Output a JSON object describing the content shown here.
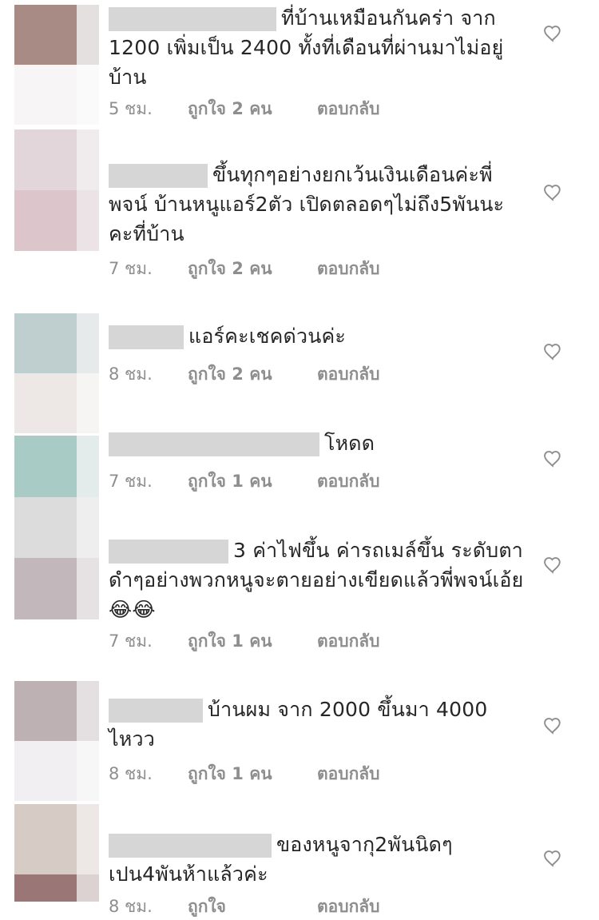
{
  "comments": [
    {
      "text": "ที่บ้านเหมือนกันคร่า จาก 1200 เพิ่มเป็น 2400 ทั้งที่เดือนที่ผ่านมาไม่อยู่บ้าน",
      "time": "5 ชม.",
      "likes": "ถูกใจ 2 คน",
      "reply": "ตอบกลับ",
      "avatar_colors": [
        "#a98b86",
        "#ece4e3"
      ]
    },
    {
      "text": "ขึ้นทุกๆอย่างยกเว้นเงินเดือนค่ะพี่พจน์ บ้านหนูแอร์2ตัว เปิดตลอดๆไม่ถึง5พันนะคะที่บ้าน",
      "time": "7 ชม.",
      "likes": "ถูกใจ 2 คน",
      "reply": "ตอบกลับ",
      "avatar_colors": [
        "#e2d6da",
        "#ddc5cc"
      ]
    },
    {
      "text": "แอร์คะเชคด่วนค่ะ",
      "time": "8 ชม.",
      "likes": "ถูกใจ 2 คน",
      "reply": "ตอบกลับ",
      "avatar_colors": [
        "#bfcfcf",
        "#ede8e5"
      ]
    },
    {
      "text": "โหดด",
      "time": "7 ชม.",
      "likes": "ถูกใจ 1 คน",
      "reply": "ตอบกลับ",
      "avatar_colors": [
        "#a9cbc6",
        "#dcdcdd"
      ]
    },
    {
      "text": "3 ค่าไฟขึ้น ค่ารถเมล์ขึ้น ระดับตาดำๆอย่างพวกหนูจะตายอย่างเขียดแล้วพี่พจน์เอ้ย😂😂",
      "time": "7 ชม.",
      "likes": "ถูกใจ 1 คน",
      "reply": "ตอบกลับ",
      "avatar_colors": [
        "#e0dde0",
        "#c2b8bb"
      ]
    },
    {
      "text": "บ้านผม จาก 2000 ขึ้นมา 4000 ไหวว",
      "time": "8 ชม.",
      "likes": "ถูกใจ 1 คน",
      "reply": "ตอบกลับ",
      "avatar_colors": [
        "#bdb1b3",
        "#f1eff2"
      ]
    },
    {
      "text": "ของหนูจากุ2พันนิดๆ เปน4พันห้าแล้วค่ะ",
      "time": "8 ชม.",
      "likes": "ถูกใจ",
      "reply": "ตอบกลับ",
      "avatar_colors": [
        "#d7cbc6",
        "#9a7676"
      ]
    }
  ],
  "colors": {
    "text": "#262626",
    "meta": "#8e8e8e",
    "redaction": "#d6d6d6"
  },
  "icons": {
    "like": "heart-outline-icon"
  }
}
